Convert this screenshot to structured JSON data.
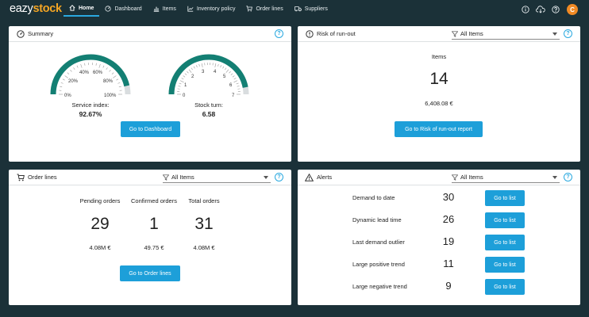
{
  "app": {
    "logo_prefix": "eazy",
    "logo_suffix": "stock",
    "user_initial": "C"
  },
  "nav": [
    {
      "label": "Home",
      "icon": "home-icon",
      "active": true
    },
    {
      "label": "Dashboard",
      "icon": "gauge-icon",
      "active": false
    },
    {
      "label": "Items",
      "icon": "bar-chart-icon",
      "active": false
    },
    {
      "label": "Inventory policy",
      "icon": "line-chart-icon",
      "active": false
    },
    {
      "label": "Order lines",
      "icon": "cart-icon",
      "active": false
    },
    {
      "label": "Suppliers",
      "icon": "truck-icon",
      "active": false
    }
  ],
  "summary": {
    "title": "Summary",
    "service_gauge": {
      "ticks": [
        "0%",
        "20%",
        "40%",
        "60%",
        "80%",
        "100%"
      ],
      "fill_fraction": 0.9267
    },
    "service_label": "Service index:",
    "service_value": "92.67%",
    "stock_gauge": {
      "ticks": [
        "0",
        "1",
        "2",
        "3",
        "4",
        "5",
        "6",
        "7"
      ],
      "fill_fraction": 0.94
    },
    "stock_label": "Stock turn:",
    "stock_value": "6.58",
    "button": "Go to Dashboard"
  },
  "risk": {
    "title": "Risk of run-out",
    "filter": "All Items",
    "items_label": "Items",
    "items_value": "14",
    "amount": "6,408.08 €",
    "button": "Go to Risk of run-out report"
  },
  "orders": {
    "title": "Order lines",
    "filter": "All Items",
    "columns": [
      {
        "label": "Pending orders",
        "count": "29",
        "amount": "4.08M €"
      },
      {
        "label": "Confirmed orders",
        "count": "1",
        "amount": "49.75 €"
      },
      {
        "label": "Total orders",
        "count": "31",
        "amount": "4.08M €"
      }
    ],
    "button": "Go to Order lines"
  },
  "alerts": {
    "title": "Alerts",
    "filter": "All Items",
    "rows": [
      {
        "label": "Demand to date",
        "count": "30",
        "button": "Go to list"
      },
      {
        "label": "Dynamic lead time",
        "count": "26",
        "button": "Go to list"
      },
      {
        "label": "Last demand outlier",
        "count": "19",
        "button": "Go to list"
      },
      {
        "label": "Large positive trend",
        "count": "11",
        "button": "Go to list"
      },
      {
        "label": "Large negative trend",
        "count": "9",
        "button": "Go to list"
      }
    ]
  },
  "colors": {
    "accent": "#1d9fd9",
    "gauge": "#137f73",
    "background": "#1b3138",
    "avatar": "#f08a24"
  }
}
